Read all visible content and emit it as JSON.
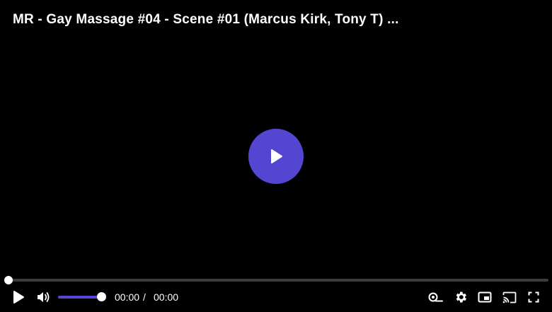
{
  "video": {
    "title": "MR - Gay Massage #04 - Scene #01 (Marcus Kirk, Tony T) ..."
  },
  "controls": {
    "current_time": "00:00",
    "separator": "/",
    "duration": "00:00",
    "progress": 0,
    "volume": 1.0,
    "icons": {
      "big_play": "play-icon",
      "play": "play-icon",
      "volume": "volume-icon",
      "captions": "captions-icon",
      "settings": "gear-icon",
      "pip": "picture-in-picture-icon",
      "cast": "cast-icon",
      "fullscreen": "fullscreen-icon"
    }
  },
  "colors": {
    "accent": "#5546d2",
    "background": "#000000",
    "track": "#3b3b3b",
    "text": "#ffffff"
  }
}
